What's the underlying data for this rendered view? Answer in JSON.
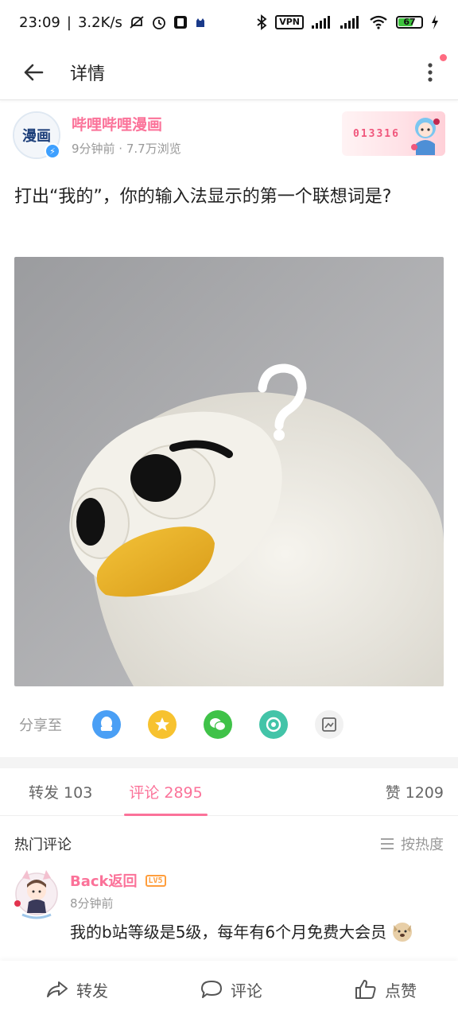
{
  "status_bar": {
    "time": "23:09",
    "net_speed": "3.2K/s",
    "vpn": "VPN",
    "battery_level": "67",
    "battery_fraction": 0.67
  },
  "top_bar": {
    "title": "详情",
    "back_icon": "arrow-left-icon",
    "more_icon": "more-vertical-icon"
  },
  "post": {
    "author": "哔哩哔哩漫画",
    "avatar_text": "漫画",
    "meta": "9分钟前 · 7.7万浏览",
    "fan_badge_number": "013316",
    "text": "打出“我的”，你的输入法显示的第一个联想词是?"
  },
  "share": {
    "label": "分享至",
    "targets": [
      "qq-icon",
      "qzone-icon",
      "wechat-icon",
      "moments-icon",
      "screenshot-icon"
    ],
    "colors": [
      "#4a9ff5",
      "#f7c22f",
      "#3fc248",
      "#43c4a8",
      "#f1f1f1"
    ]
  },
  "tabs": {
    "repost": "转发 103",
    "comment": "评论 2895",
    "like": "赞 1209"
  },
  "hot": {
    "title": "热门评论",
    "sort": "按热度"
  },
  "comment": {
    "user": "Back返回",
    "level": "LV5",
    "time": "8分钟前",
    "text": "我的b站等级是5级，每年有6个月免费大会员"
  },
  "bottom_bar": {
    "repost": "转发",
    "comment": "评论",
    "like": "点赞"
  },
  "colors": {
    "accent_pink": "#fb7299",
    "meta_gray": "#999999"
  }
}
